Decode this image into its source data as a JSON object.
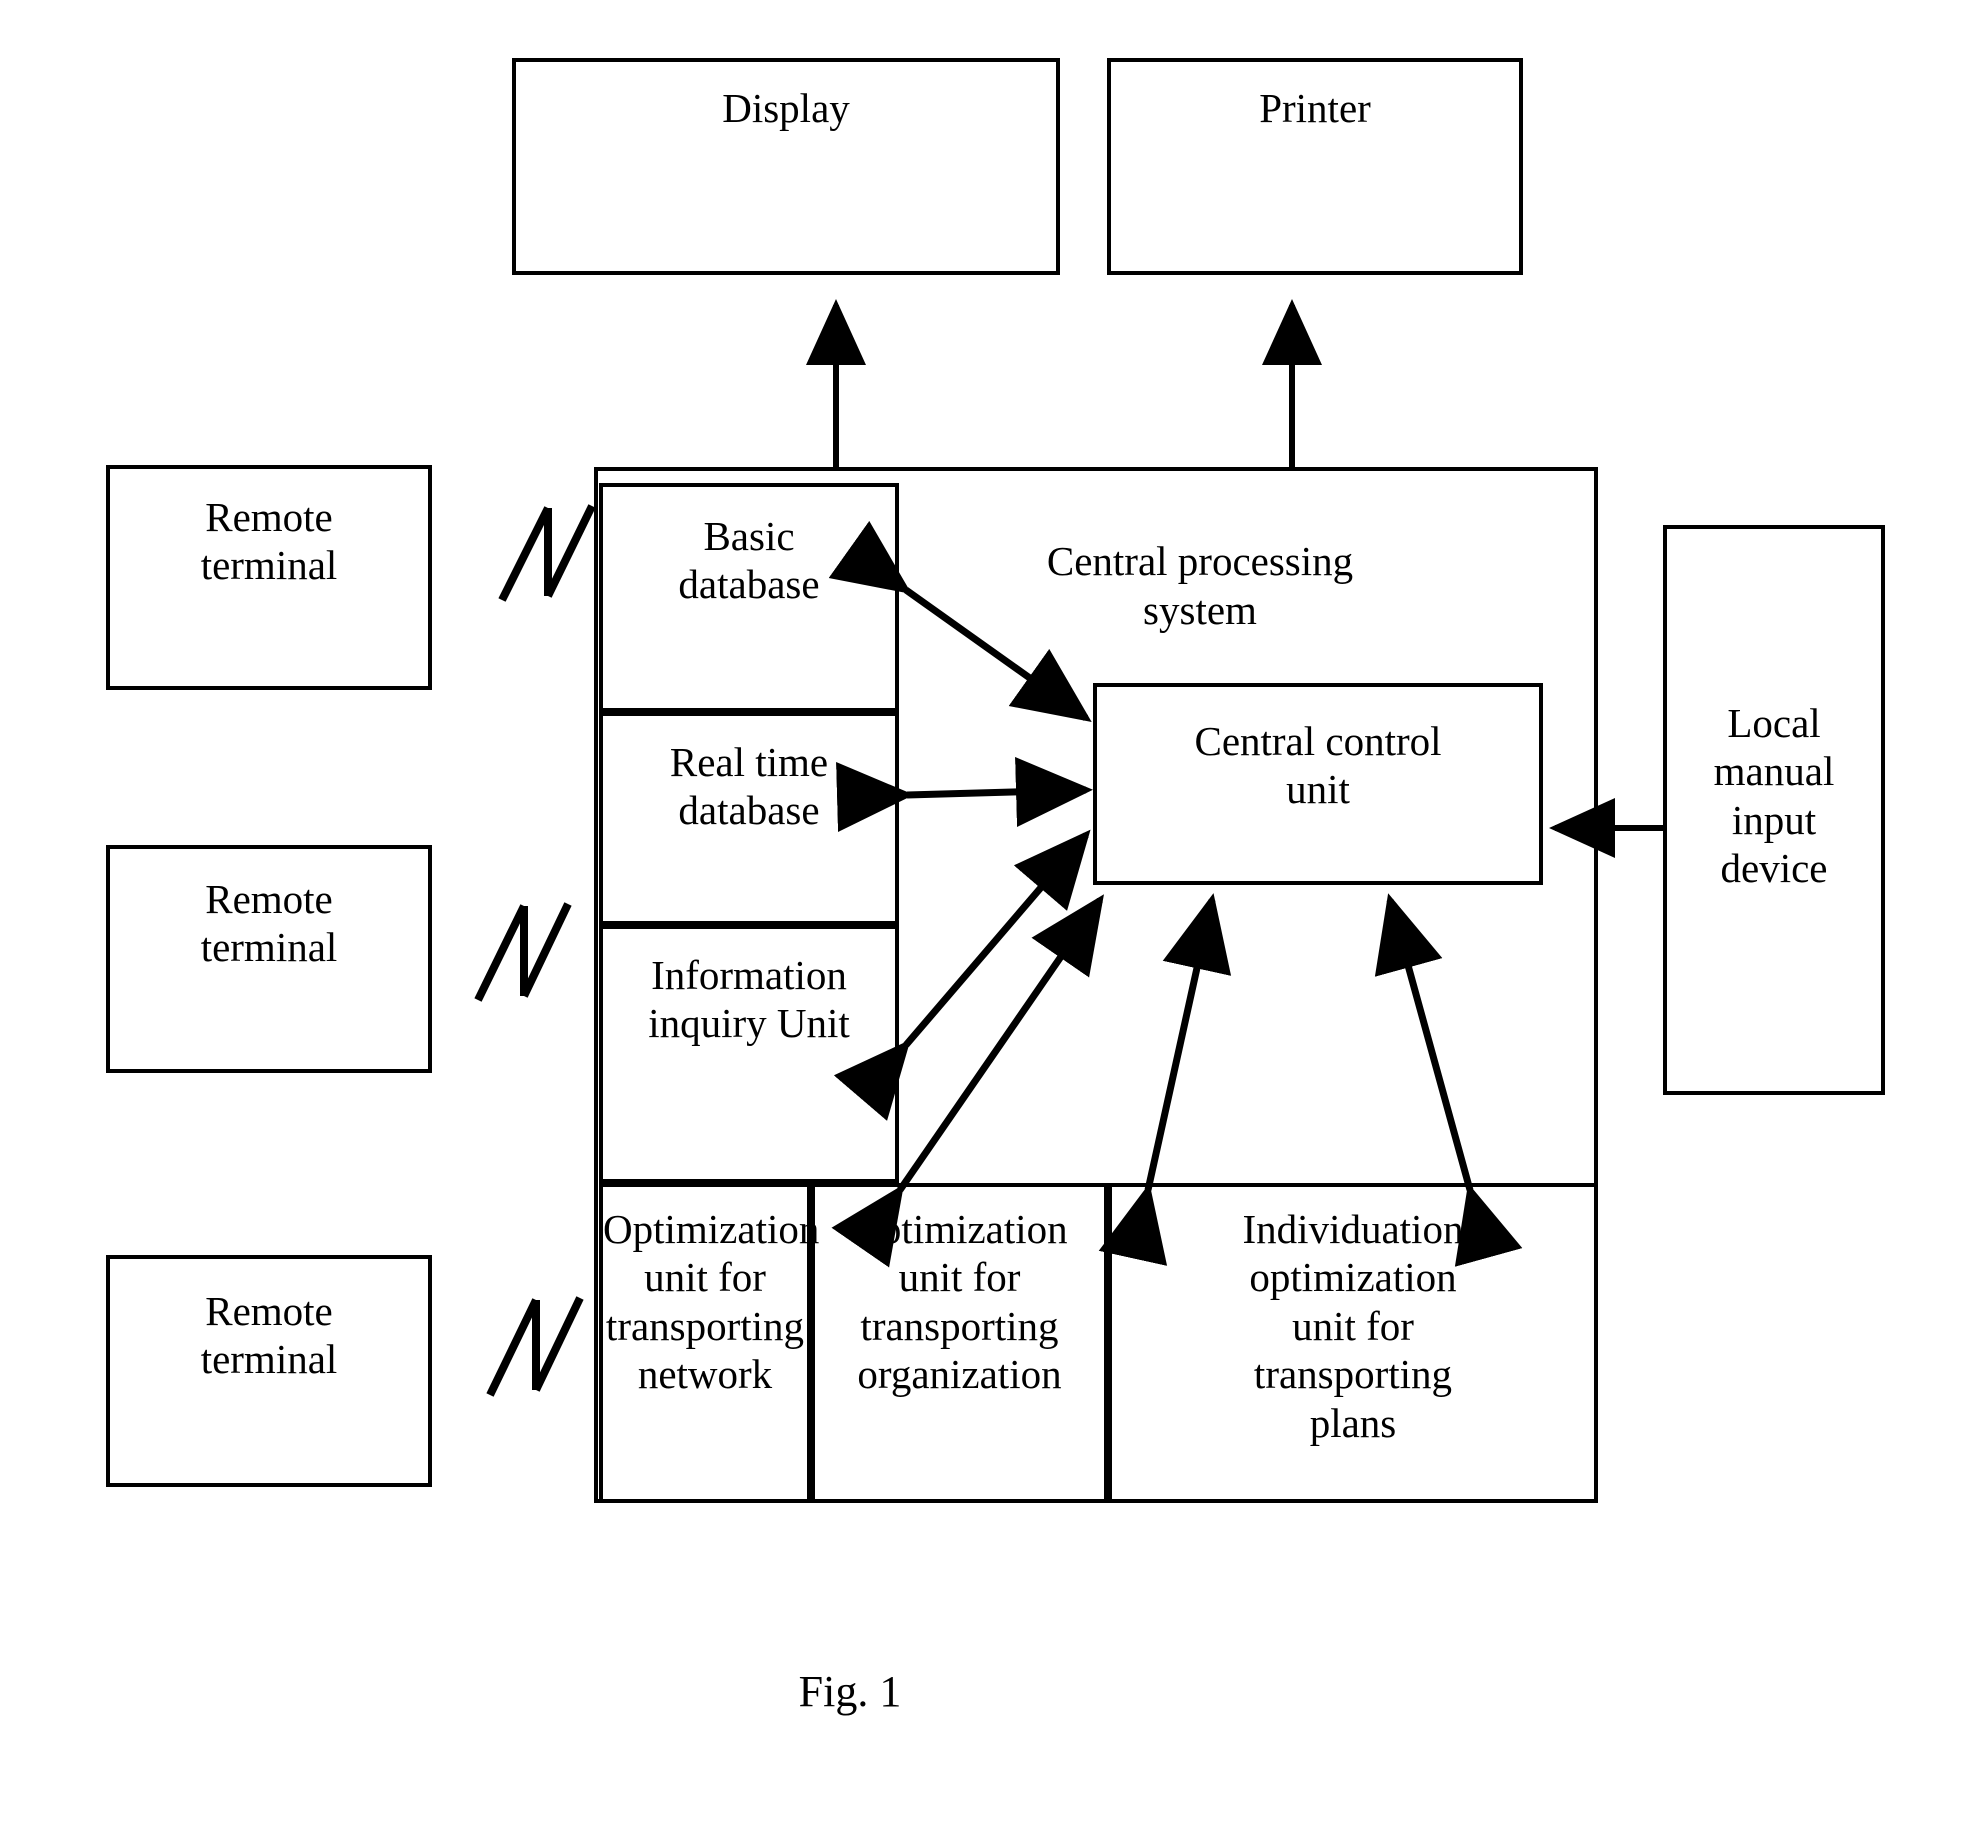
{
  "figure": {
    "caption": "Fig. 1",
    "type": "block-diagram",
    "stroke_color": "#000000",
    "background_color": "#ffffff"
  },
  "output_devices": [
    {
      "id": "display",
      "label": "Display"
    },
    {
      "id": "printer",
      "label": "Printer"
    }
  ],
  "remote_terminals": [
    {
      "id": "remote-terminal-1",
      "label": "Remote\nterminal"
    },
    {
      "id": "remote-terminal-2",
      "label": "Remote\nterminal"
    },
    {
      "id": "remote-terminal-3",
      "label": "Remote\nterminal"
    }
  ],
  "central_processing_system": {
    "title": "Central processing\nsystem",
    "central_control_unit": {
      "label": "Central control\nunit"
    },
    "data_units": [
      {
        "id": "basic-database",
        "label": "Basic\ndatabase"
      },
      {
        "id": "real-time-database",
        "label": "Real time\ndatabase"
      },
      {
        "id": "information-inquiry-unit",
        "label": "Information\ninquiry Unit"
      }
    ],
    "optimization_units": [
      {
        "id": "optimization-unit-transporting-network",
        "label": "Optimization\nunit for\ntransporting\nnetwork"
      },
      {
        "id": "optimization-unit-transporting-organization",
        "label": "Optimization\nunit for\ntransporting\norganization"
      },
      {
        "id": "individuation-optimization-unit-transporting-plans",
        "label": "Individuation\noptimization\nunit for\ntransporting\nplans"
      }
    ]
  },
  "input_devices": [
    {
      "id": "local-manual-input-device",
      "label": "Local\nmanual\ninput\ndevice"
    }
  ],
  "connections": [
    {
      "from": "central-processing-system",
      "to": "display",
      "style": "single-arrow-up"
    },
    {
      "from": "central-processing-system",
      "to": "printer",
      "style": "single-arrow-up"
    },
    {
      "from": "basic-database",
      "to": "central-control-unit",
      "style": "double-arrow"
    },
    {
      "from": "real-time-database",
      "to": "central-control-unit",
      "style": "double-arrow"
    },
    {
      "from": "information-inquiry-unit",
      "to": "central-control-unit",
      "style": "double-arrow"
    },
    {
      "from": "optimization-unit-transporting-network",
      "to": "central-control-unit",
      "style": "double-arrow"
    },
    {
      "from": "optimization-unit-transporting-organization",
      "to": "central-control-unit",
      "style": "double-arrow"
    },
    {
      "from": "individuation-optimization-unit-transporting-plans",
      "to": "central-control-unit",
      "style": "double-arrow"
    },
    {
      "from": "local-manual-input-device",
      "to": "central-control-unit",
      "style": "single-arrow-left"
    },
    {
      "from": "remote-terminal-1",
      "to": "central-processing-system",
      "style": "break-symbol"
    },
    {
      "from": "remote-terminal-2",
      "to": "central-processing-system",
      "style": "break-symbol"
    },
    {
      "from": "remote-terminal-3",
      "to": "central-processing-system",
      "style": "break-symbol"
    }
  ]
}
